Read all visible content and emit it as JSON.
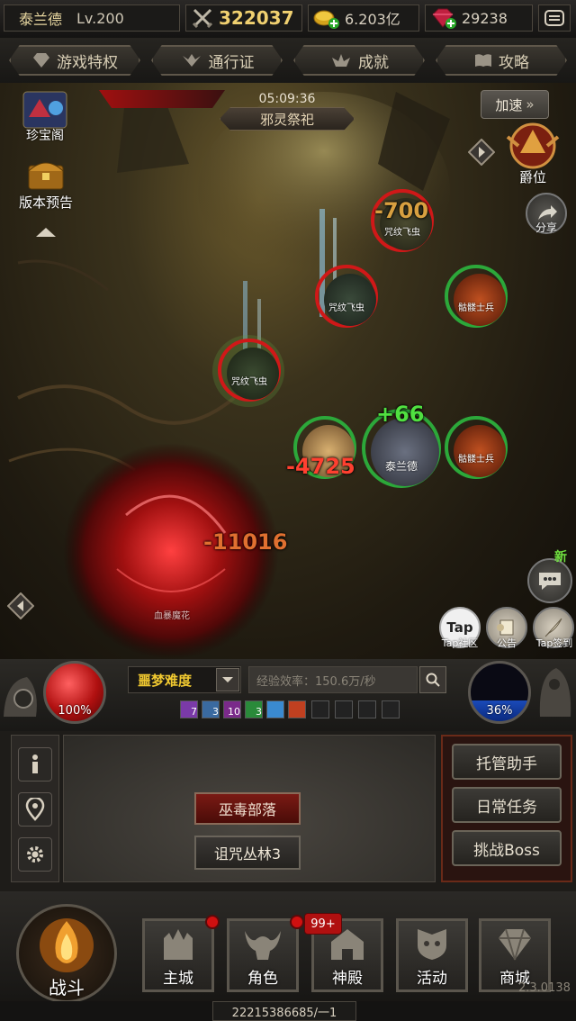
{
  "top": {
    "player_name": "泰兰德",
    "level": "Lv.200",
    "power": "322037",
    "gold": "6.203亿",
    "gems": "29238"
  },
  "nav": [
    {
      "label": "游戏特权"
    },
    {
      "label": "通行证"
    },
    {
      "label": "成就"
    },
    {
      "label": "攻略"
    }
  ],
  "field": {
    "timer": "05:09:36",
    "stage_name": "邪灵祭祀",
    "speed_label": "加速",
    "left_icons": [
      {
        "label": "珍宝阁"
      },
      {
        "label": "版本预告"
      }
    ],
    "rank_label": "爵位",
    "share_label": "分享",
    "enemies": [
      {
        "name": "咒纹飞虫"
      },
      {
        "name": "咒纹飞虫"
      },
      {
        "name": "咒纹飞虫"
      },
      {
        "name": "血暴魔花"
      }
    ],
    "allies": [
      {
        "name": "骷髅士兵"
      },
      {
        "name": "泰兰德"
      },
      {
        "name": "骷髅士兵"
      }
    ],
    "damage_numbers": [
      "-700",
      "+66",
      "-4725",
      "-11016"
    ],
    "new_badge": "新",
    "tap_label": "Tap",
    "bottom_right_icons": [
      {
        "label": "Tap社区"
      },
      {
        "label": "公告"
      },
      {
        "label": "Tap签到"
      }
    ]
  },
  "control": {
    "hp_percent": "100%",
    "mp_percent": "36%",
    "difficulty": "噩梦难度",
    "exp_rate": "经验效率：150.6万/秒",
    "skills": [
      {
        "count": "7",
        "color": "#7a3aa8"
      },
      {
        "count": "3",
        "color": "#3a6aa0"
      },
      {
        "count": "10",
        "color": "#7a2a8a"
      },
      {
        "count": "3",
        "color": "#2a8a3a"
      },
      {
        "count": "",
        "color": "#3a8ad0"
      },
      {
        "count": "",
        "color": "#c04020"
      }
    ]
  },
  "panel": {
    "map_buttons": [
      {
        "label": "巫毒部落"
      },
      {
        "label": "诅咒丛林3"
      }
    ],
    "side_buttons": [
      {
        "label": "托管助手"
      },
      {
        "label": "日常任务"
      },
      {
        "label": "挑战Boss"
      }
    ]
  },
  "bottom": {
    "battle_label": "战斗",
    "tabs": [
      {
        "label": "主城"
      },
      {
        "label": "角色"
      },
      {
        "label": "神殿"
      },
      {
        "label": "活动"
      },
      {
        "label": "商城"
      }
    ],
    "badge_count": "99+",
    "footer_id": "22215386685/一1",
    "version": "2.3.0138"
  }
}
